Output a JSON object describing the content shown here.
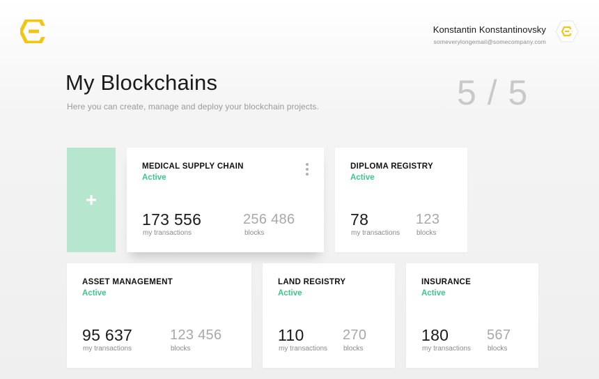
{
  "brand": {
    "accent": "#f2c513",
    "green": "#3ec58a",
    "add_tile_color": "#b7e6cf"
  },
  "user": {
    "name": "Konstantin Konstantinovsky",
    "email": "someverylongemail@somecompany.com"
  },
  "header": {
    "title": "My Blockchains",
    "subtitle": "Here you can create, manage and deploy your blockchain projects.",
    "counter": "5 / 5"
  },
  "add_tile": {
    "icon": "plus-icon",
    "label": "+"
  },
  "cards": [
    {
      "title": "MEDICAL SUPPLY CHAIN",
      "status": "Active",
      "transactions": "173 556",
      "transactions_label": "my transactions",
      "blocks": "256 486",
      "blocks_label": "blocks",
      "menu_icon": "more-vertical-icon"
    },
    {
      "title": "DIPLOMA REGISTRY",
      "status": "Active",
      "transactions": "78",
      "transactions_label": "my transactions",
      "blocks": "123",
      "blocks_label": "blocks"
    },
    {
      "title": "ASSET MANAGEMENT",
      "status": "Active",
      "transactions": "95 637",
      "transactions_label": "my transactions",
      "blocks": "123 456",
      "blocks_label": "blocks"
    },
    {
      "title": "LAND REGISTRY",
      "status": "Active",
      "transactions": "110",
      "transactions_label": "my transactions",
      "blocks": "270",
      "blocks_label": "blocks"
    },
    {
      "title": "INSURANCE",
      "status": "Active",
      "transactions": "180",
      "transactions_label": "my transactions",
      "blocks": "567",
      "blocks_label": "blocks"
    }
  ]
}
